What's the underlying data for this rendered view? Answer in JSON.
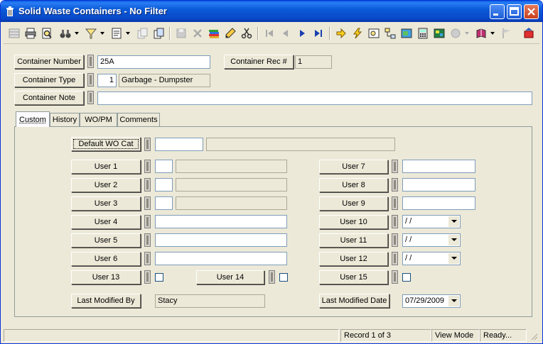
{
  "window": {
    "title": "Solid Waste Containers - No Filter",
    "icon": "trash-can-icon"
  },
  "header_fields": {
    "container_number": {
      "label": "Container Number",
      "value": "25A"
    },
    "container_rec": {
      "label": "Container Rec #",
      "value": "1"
    },
    "container_type": {
      "label": "Container Type",
      "code": "1",
      "description": "Garbage - Dumpster"
    },
    "container_note": {
      "label": "Container Note",
      "value": ""
    }
  },
  "tabs": [
    {
      "label": "Custom",
      "active": true
    },
    {
      "label": "History",
      "active": false
    },
    {
      "label": "WO/PM",
      "active": false
    },
    {
      "label": "Comments",
      "active": false
    }
  ],
  "custom": {
    "default_wo_cat": {
      "label": "Default WO Cat",
      "code": "",
      "description": ""
    },
    "user1": {
      "label": "User 1",
      "code": "",
      "description": ""
    },
    "user2": {
      "label": "User 2",
      "code": "",
      "description": ""
    },
    "user3": {
      "label": "User 3",
      "code": "",
      "description": ""
    },
    "user4": {
      "label": "User 4",
      "value": ""
    },
    "user5": {
      "label": "User 5",
      "value": ""
    },
    "user6": {
      "label": "User 6",
      "value": ""
    },
    "user7": {
      "label": "User 7",
      "value": ""
    },
    "user8": {
      "label": "User 8",
      "value": ""
    },
    "user9": {
      "label": "User 9",
      "value": ""
    },
    "user10": {
      "label": "User 10",
      "value": " / /"
    },
    "user11": {
      "label": "User 11",
      "value": " / /"
    },
    "user12": {
      "label": "User 12",
      "value": " / /"
    },
    "user13": {
      "label": "User 13",
      "checked": false
    },
    "user14": {
      "label": "User 14",
      "checked": false
    },
    "user15": {
      "label": "User 15",
      "checked": false
    },
    "last_modified_by": {
      "label": "Last Modified By",
      "value": "Stacy"
    },
    "last_modified_date": {
      "label": "Last Modified Date",
      "value": "07/29/2009"
    }
  },
  "status": {
    "record": "Record 1 of 3",
    "mode": "View Mode",
    "state": "Ready..."
  },
  "colors": {
    "titlebar": "#0b5bd8",
    "face": "#ece9d8",
    "nav_arrow": "#1a3fb0"
  }
}
